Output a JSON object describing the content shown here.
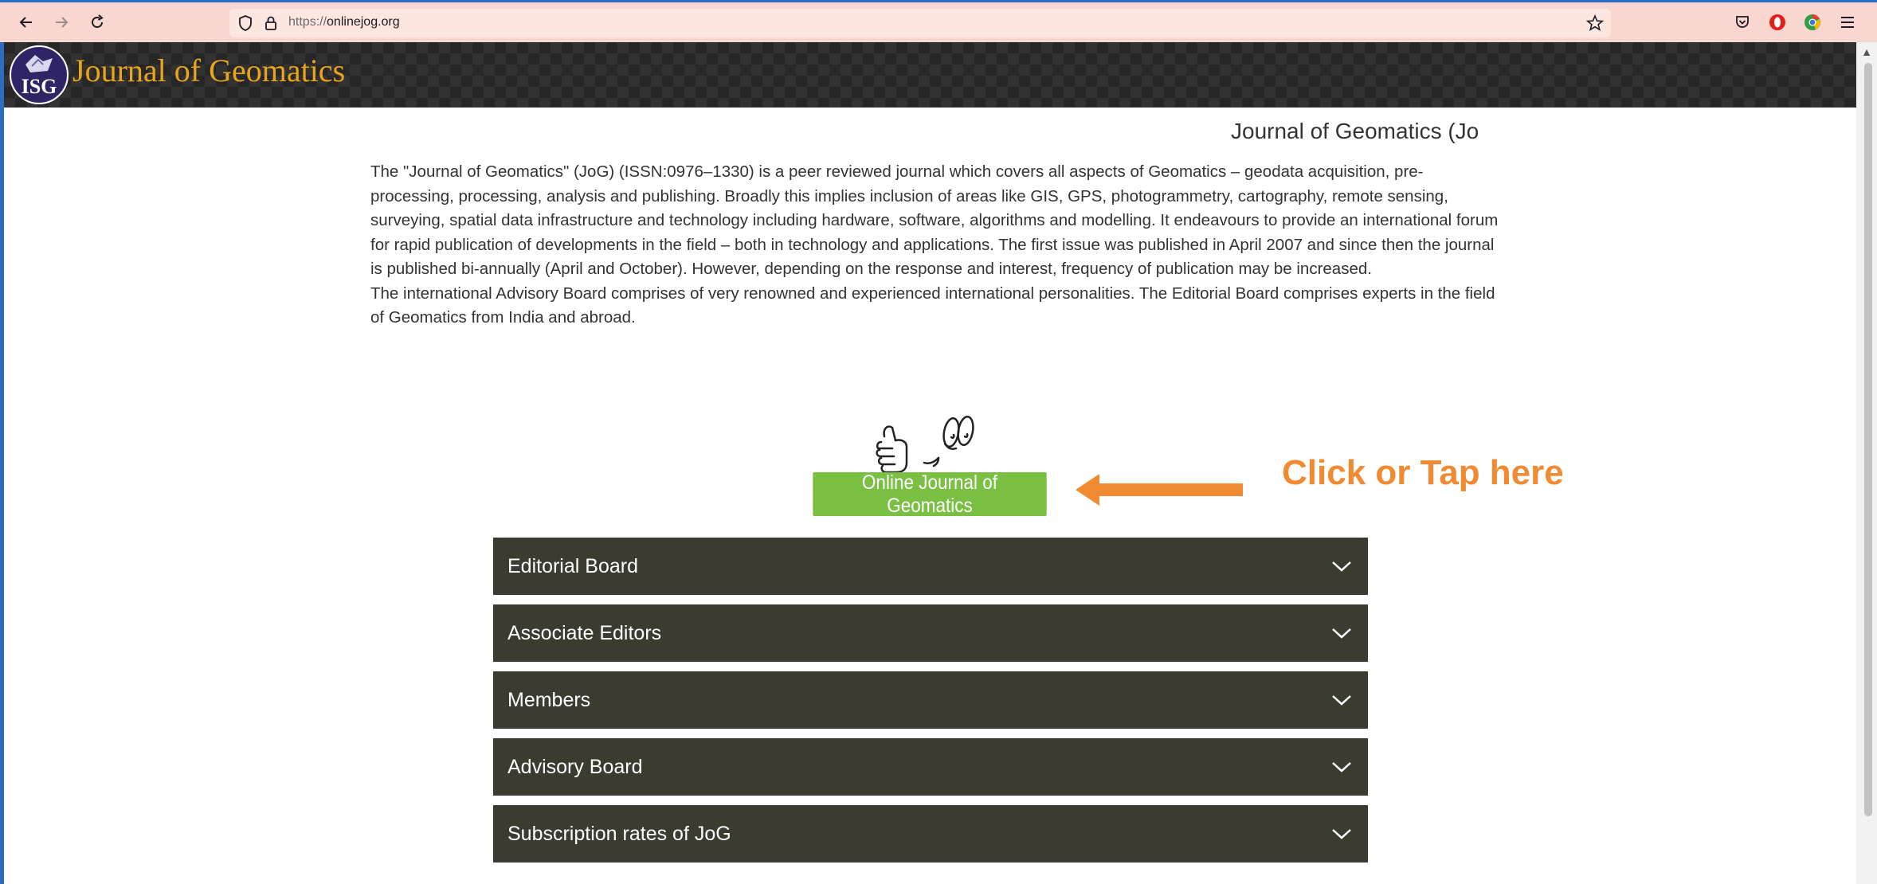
{
  "browser": {
    "url_prefix": "https://",
    "url_domain": "onlinejog.org"
  },
  "header": {
    "site_name": "Journal of Geomatics",
    "logo_text": "ISG"
  },
  "main": {
    "page_title": "Journal of Geomatics (Jo",
    "intro_p1": "The \"Journal of Geomatics\" (JoG) (ISSN:0976–1330) is a peer reviewed journal which covers all aspects of Geomatics – geodata acquisition, pre-processing, processing, analysis and publishing. Broadly this implies inclusion of areas like GIS, GPS, photogrammetry, cartography, remote sensing, surveying, spatial data infrastructure and technology including hardware, software, algorithms and modelling. It endeavours to provide an international forum for rapid publication of developments in the field – both in technology and applications. The first issue was published in April 2007 and since then the journal is published bi-annually (April and October). However, depending on the response and interest, frequency of publication may be increased.",
    "intro_p2": "The international Advisory Board comprises of very renowned and experienced international personalities. The Editorial Board comprises experts in the field of Geomatics from India and abroad.",
    "online_button": "Online Journal of Geomatics",
    "callout": "Click or Tap here",
    "accent_green": "#7ac143",
    "accent_orange": "#f08a33"
  },
  "accordion": [
    {
      "label": "Editorial Board"
    },
    {
      "label": "Associate Editors"
    },
    {
      "label": "Members"
    },
    {
      "label": "Advisory Board"
    },
    {
      "label": "Subscription rates of JoG"
    }
  ],
  "icons": {
    "back": "arrow-left-icon",
    "forward": "arrow-right-icon",
    "reload": "reload-icon",
    "shield": "shield-icon",
    "lock": "lock-icon",
    "bookmark": "star-icon",
    "pocket": "pocket-icon",
    "extension1": "opera-icon",
    "extension2": "chrome-icon",
    "menu": "hamburger-icon",
    "chevron": "chevron-down-icon"
  }
}
